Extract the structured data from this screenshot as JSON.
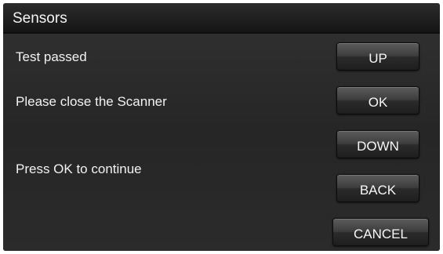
{
  "window": {
    "title": "Sensors"
  },
  "messages": {
    "line1": "Test passed",
    "line2": "Please close the Scanner",
    "line3": "Press OK to continue"
  },
  "buttons": {
    "up": "UP",
    "ok": "OK",
    "down": "DOWN",
    "back": "BACK",
    "cancel": "CANCEL"
  },
  "colors": {
    "background": "#2a2a2a",
    "text": "#f2f2f2"
  }
}
